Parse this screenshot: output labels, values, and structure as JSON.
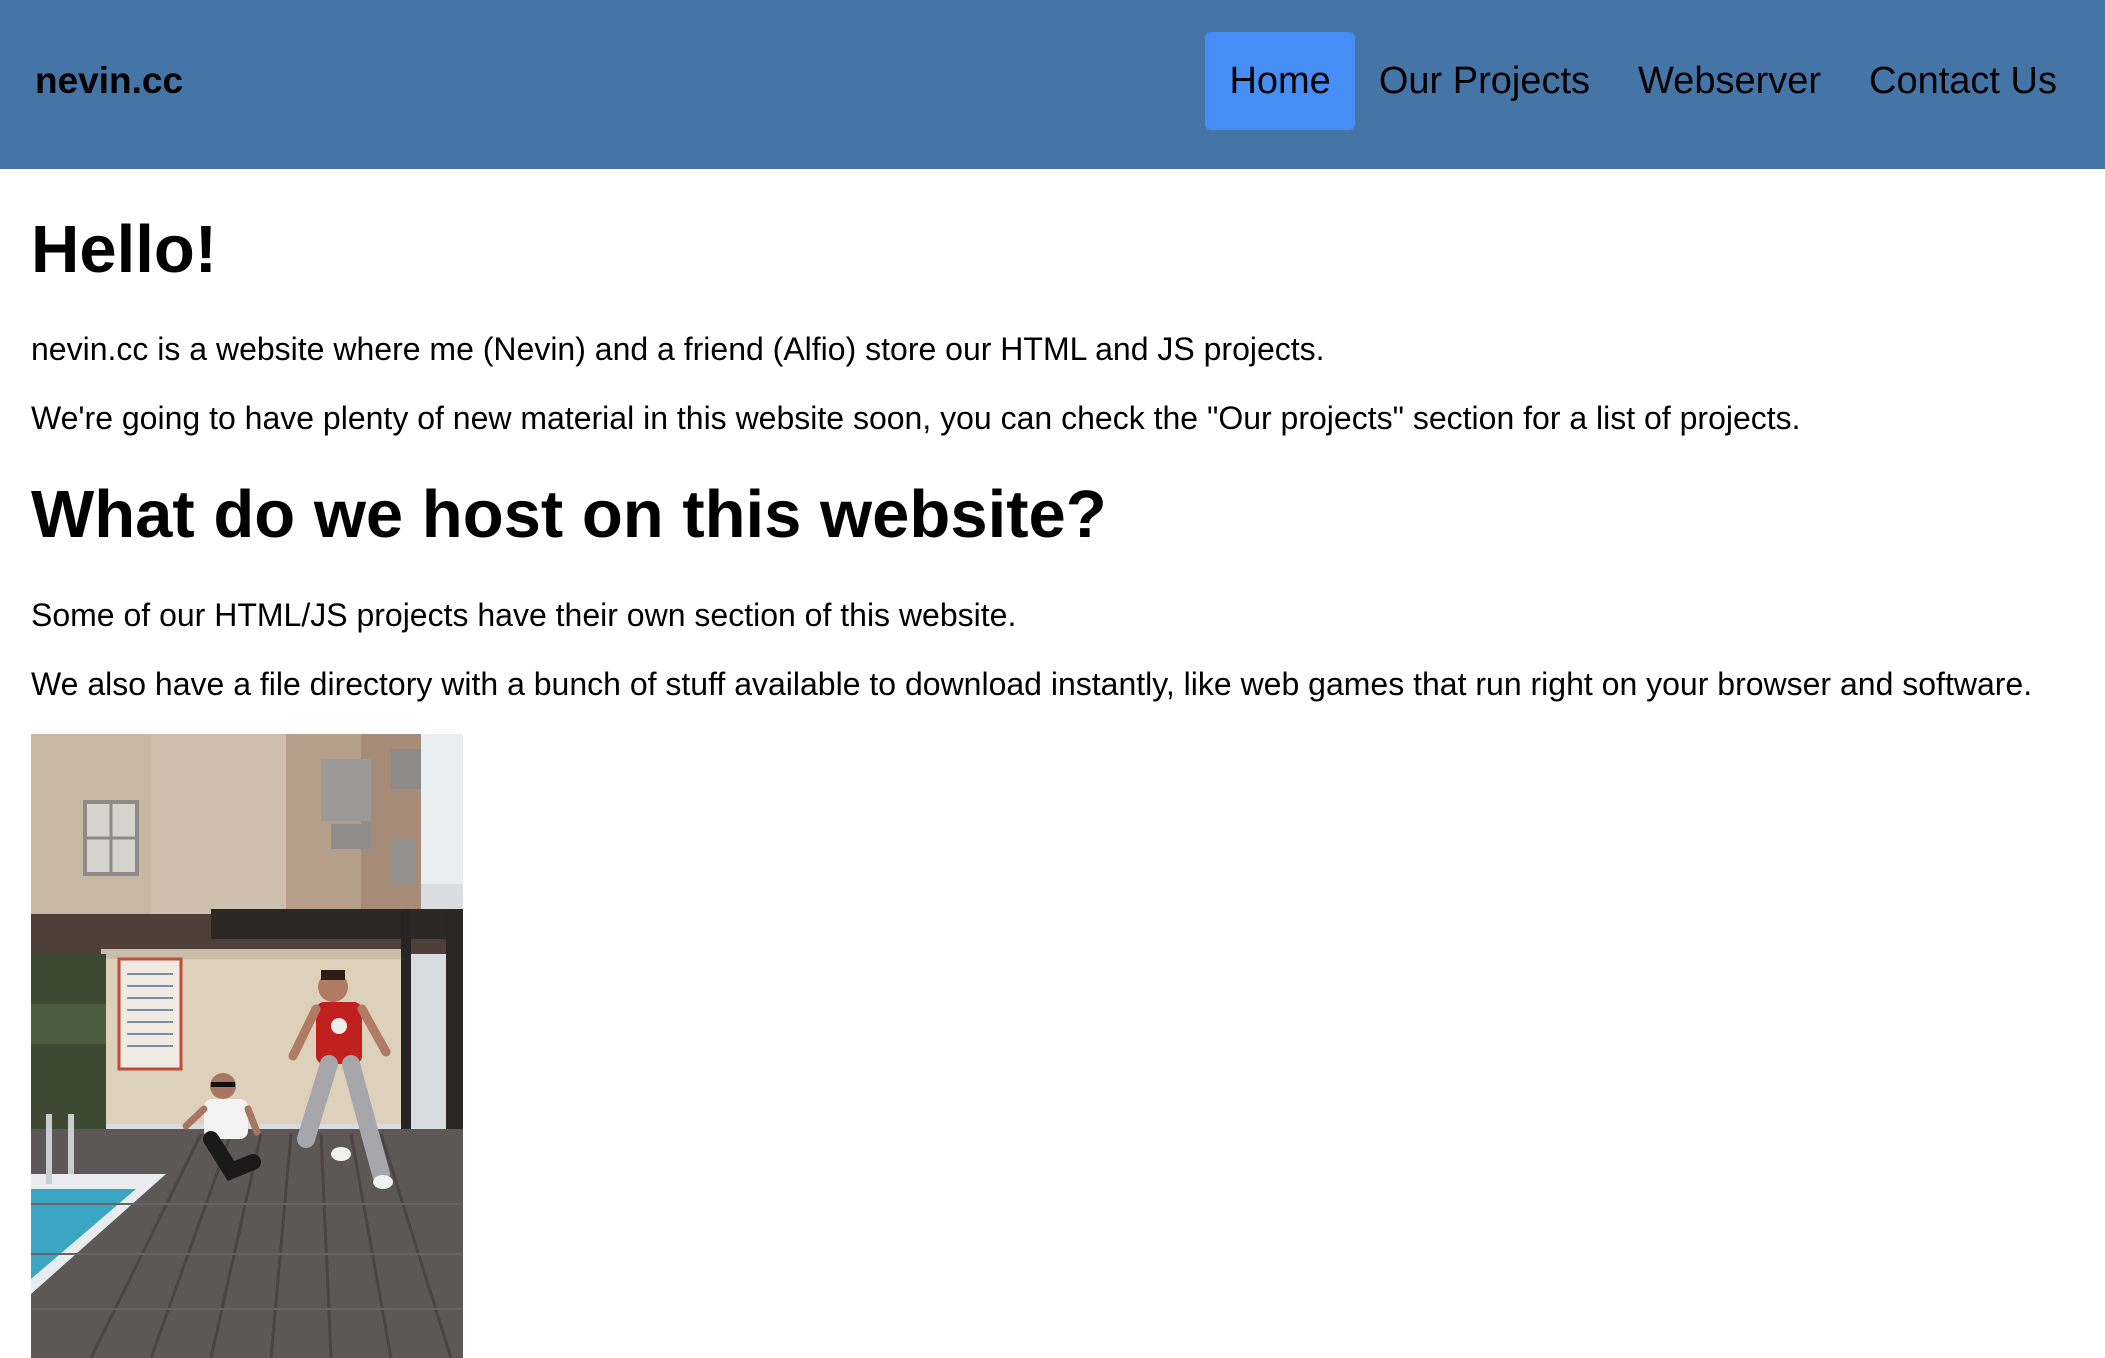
{
  "header": {
    "brand": "nevin.cc",
    "nav": [
      {
        "label": "Home",
        "active": true
      },
      {
        "label": "Our Projects",
        "active": false
      },
      {
        "label": "Webserver",
        "active": false
      },
      {
        "label": "Contact Us",
        "active": false
      }
    ]
  },
  "main": {
    "heading1": "Hello!",
    "intro_paragraph": "nevin.cc is a website where me (Nevin) and a friend (Alfio) store our HTML and JS projects.",
    "projects_paragraph": "We're going to have plenty of new material in this website soon, you can check the \"Our projects\" section for a list of projects.",
    "heading2": "What do we host on this website?",
    "sections_paragraph": "Some of our HTML/JS projects have their own section of this website.",
    "files_paragraph": "We also have a file directory with a bunch of stuff available to download instantly, like web games that run right on your browser and software."
  },
  "colors": {
    "navbar": "#4475a6",
    "nav_active": "#468ef6"
  }
}
